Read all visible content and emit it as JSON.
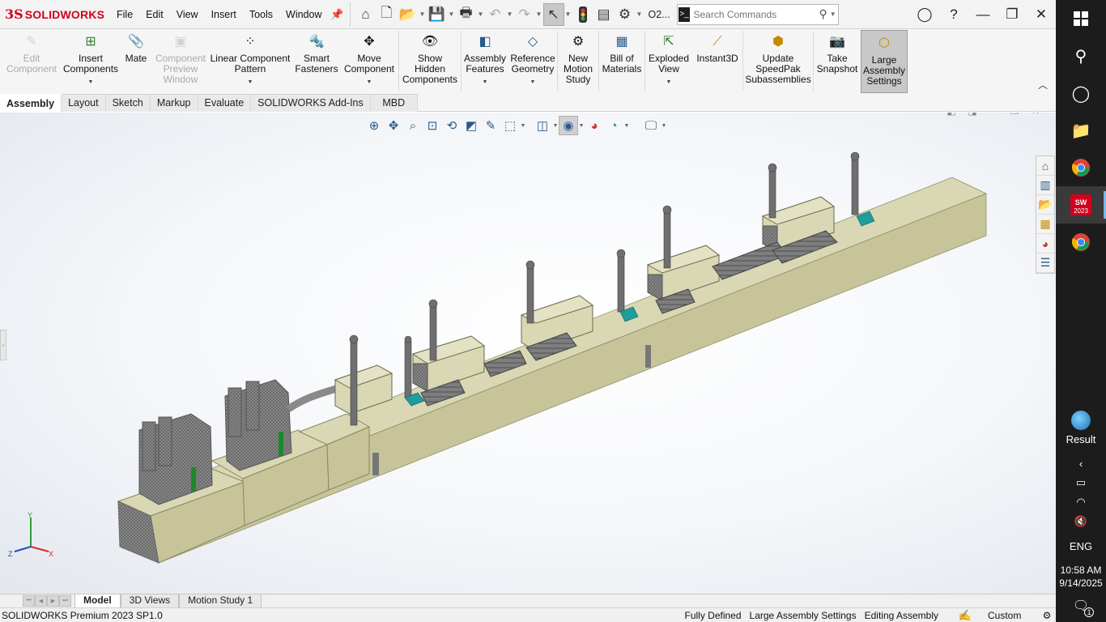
{
  "app": {
    "logo_mark": "3S",
    "logo_text": "SOLIDWORKS"
  },
  "menu": [
    "File",
    "Edit",
    "View",
    "Insert",
    "Tools",
    "Window"
  ],
  "quick_access": {
    "doc_label": "O2...",
    "search_placeholder": "Search Commands"
  },
  "ribbon": [
    {
      "label": "Edit\nComponent",
      "icon": "edit-component-icon",
      "enabled": false,
      "dropdown": false
    },
    {
      "label": "Insert\nComponents",
      "icon": "insert-components-icon",
      "enabled": true,
      "dropdown": true
    },
    {
      "label": "Mate",
      "icon": "mate-icon",
      "enabled": true,
      "dropdown": false
    },
    {
      "label": "Component\nPreview\nWindow",
      "icon": "component-preview-icon",
      "enabled": false,
      "dropdown": false
    },
    {
      "label": "Linear Component\nPattern",
      "icon": "linear-pattern-icon",
      "enabled": true,
      "dropdown": true
    },
    {
      "label": "Smart\nFasteners",
      "icon": "smart-fasteners-icon",
      "enabled": true,
      "dropdown": false
    },
    {
      "label": "Move\nComponent",
      "icon": "move-component-icon",
      "enabled": true,
      "dropdown": true
    },
    {
      "label": "Show\nHidden\nComponents",
      "icon": "show-hidden-icon",
      "enabled": true,
      "dropdown": false
    },
    {
      "label": "Assembly\nFeatures",
      "icon": "assembly-features-icon",
      "enabled": true,
      "dropdown": true
    },
    {
      "label": "Reference\nGeometry",
      "icon": "reference-geometry-icon",
      "enabled": true,
      "dropdown": true
    },
    {
      "label": "New\nMotion\nStudy",
      "icon": "motion-study-icon",
      "enabled": true,
      "dropdown": false
    },
    {
      "label": "Bill of\nMaterials",
      "icon": "bom-icon",
      "enabled": true,
      "dropdown": false
    },
    {
      "label": "Exploded\nView",
      "icon": "exploded-view-icon",
      "enabled": true,
      "dropdown": true
    },
    {
      "label": "Instant3D",
      "icon": "instant3d-icon",
      "enabled": true,
      "dropdown": false
    },
    {
      "label": "Update\nSpeedPak\nSubassemblies",
      "icon": "speedpak-icon",
      "enabled": true,
      "dropdown": false
    },
    {
      "label": "Take\nSnapshot",
      "icon": "snapshot-icon",
      "enabled": true,
      "dropdown": false
    },
    {
      "label": "Large\nAssembly\nSettings",
      "icon": "large-assembly-icon",
      "enabled": true,
      "dropdown": false,
      "active": true
    }
  ],
  "cm_tabs": [
    "Assembly",
    "Layout",
    "Sketch",
    "Markup",
    "Evaluate",
    "SOLIDWORKS Add-Ins",
    "MBD"
  ],
  "cm_active": "Assembly",
  "triad": {
    "x": "X",
    "y": "Y",
    "z": "Z"
  },
  "bottom_tabs": [
    "Model",
    "3D Views",
    "Motion Study 1"
  ],
  "bottom_active": "Model",
  "status": {
    "product": "SOLIDWORKS Premium 2023 SP1.0",
    "defined": "Fully Defined",
    "large_assembly": "Large Assembly Settings",
    "mode": "Editing Assembly",
    "units": "Custom"
  },
  "taskbar": {
    "app_badge": "2023",
    "result_label": "Result",
    "language": "ENG",
    "time": "10:58 AM",
    "date": "9/14/2025",
    "notif_count": "1"
  },
  "colors": {
    "brand": "#d2001c",
    "model_face": "#c7c49a",
    "model_top": "#d9d7b4",
    "model_side": "#a9a679",
    "machine_gray": "#7a7a7a",
    "teal_part": "#1e9d9b",
    "taskbar_bg": "#1c1c1c"
  }
}
